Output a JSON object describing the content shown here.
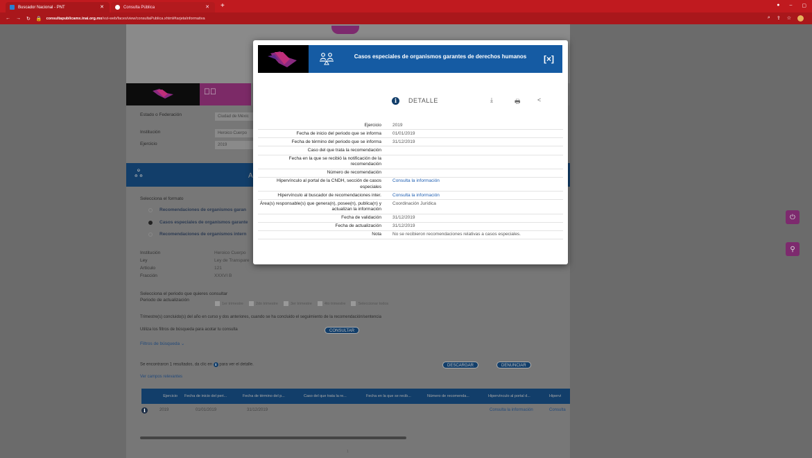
{
  "browser": {
    "tabs": [
      {
        "label": "Buscador Nacional - PNT",
        "favicon_color": "#2a7fd0"
      },
      {
        "label": "Consulta Pública",
        "favicon_color": "#ffffff"
      }
    ],
    "url_prefix": "consultapublicamx.inai.org.mx",
    "url_rest": "/vut-web/faces/view/consultaPublica.xhtml#tarjetaInformativa"
  },
  "page": {
    "filters": {
      "estado_label": "Estado o Federación",
      "estado_value": "Ciudad de Méxic",
      "institucion_label": "Institución",
      "institucion_value": "Heroico Cuerpo",
      "ejercicio_label": "Ejercicio",
      "ejercicio_value": "2019"
    },
    "band_letter": "A",
    "format_label": "Selecciona el formato",
    "formats": [
      {
        "label": "Recomendaciones de organismos garan",
        "selected": false
      },
      {
        "label": "Casos especiales de organismos garante",
        "selected": true
      },
      {
        "label": "Recomendaciones de organismos intern",
        "selected": false
      }
    ],
    "meta": [
      {
        "k": "Institución",
        "v": "Heroico Cuerpo"
      },
      {
        "k": "Ley",
        "v": "Ley de Transpare"
      },
      {
        "k": "Artículo",
        "v": "121"
      },
      {
        "k": "Fracción",
        "v": "XXXVI B"
      }
    ],
    "period_prompt": "Selecciona el periodo que quieres consultar",
    "period_label": "Periodo de actualización",
    "quarters": [
      "1er trimestre",
      "2do trimestre",
      "3er trimestre",
      "4to trimestre",
      "Seleccionar todos"
    ],
    "note": "Trimestre(s) concluido(s) del año en curso y dos anteriores, cuando se ha concluido el seguimiento de la recomendación/sentencia",
    "filters_hint": "Utiliza los filtros de búsqueda para acotar tu consulta",
    "consultar": "CONSULTAR",
    "filtros_busqueda": "Filtros de búsqueda",
    "results_text_a": "Se encontraron 1 resultados, da clic en",
    "results_text_b": "para ver el detalle.",
    "descargar": "DESCARGAR",
    "denunciar": "DENUNCIAR",
    "ver_campos": "Ver campos relevantes",
    "table_headers": [
      "Ejercicio",
      "Fecha de inicio del peri...",
      "Fecha de término del p...",
      "Caso del que trata la re...",
      "Fecha en la que se recib...",
      "Número de recomenda...",
      "Hipervínculo al portal d...",
      "Hipervi"
    ],
    "table_row": [
      "2019",
      "01/01/2019",
      "31/12/2019",
      "",
      "",
      "",
      "Consulta la información",
      "Consulta"
    ],
    "page_number": "1"
  },
  "modal": {
    "title": "Casos especiales de organismos garantes de derechos humanos",
    "close": "[×]",
    "detail_label": "DETALLE",
    "rows": [
      {
        "k": "Ejercicio",
        "v": "2019",
        "link": false
      },
      {
        "k": "Fecha de inicio del periodo que se informa",
        "v": "01/01/2019",
        "link": false
      },
      {
        "k": "Fecha de término del periodo que se informa",
        "v": "31/12/2019",
        "link": false
      },
      {
        "k": "Caso del que trata la recomendación",
        "v": "",
        "link": false
      },
      {
        "k": "Fecha en la que se recibió la notificación de la recomendación",
        "v": "",
        "link": false
      },
      {
        "k": "Número de recomendación",
        "v": "",
        "link": false
      },
      {
        "k": "Hipervínculo al portal de la CNDH, sección de casos especiales",
        "v": "Consulta la información",
        "link": true
      },
      {
        "k": "Hipervínculo al buscador de recomendaciones inter.",
        "v": "Consulta la información",
        "link": true
      },
      {
        "k": "Área(s) responsable(s) que genera(n), posee(n), publica(n) y actualizan la información",
        "v": "Coordinación Jurídica",
        "link": false
      },
      {
        "k": "Fecha de validación",
        "v": "31/12/2019",
        "link": false
      },
      {
        "k": "Fecha de actualización",
        "v": "31/12/2019",
        "link": false
      },
      {
        "k": "Nota",
        "v": "No se recibieron recomendaciones relativas a casos especiales.",
        "link": false
      }
    ]
  },
  "colors": {
    "brand_blue": "#155ba3",
    "brand_red": "#c01a1f",
    "brand_magenta": "#7d2a6e"
  }
}
